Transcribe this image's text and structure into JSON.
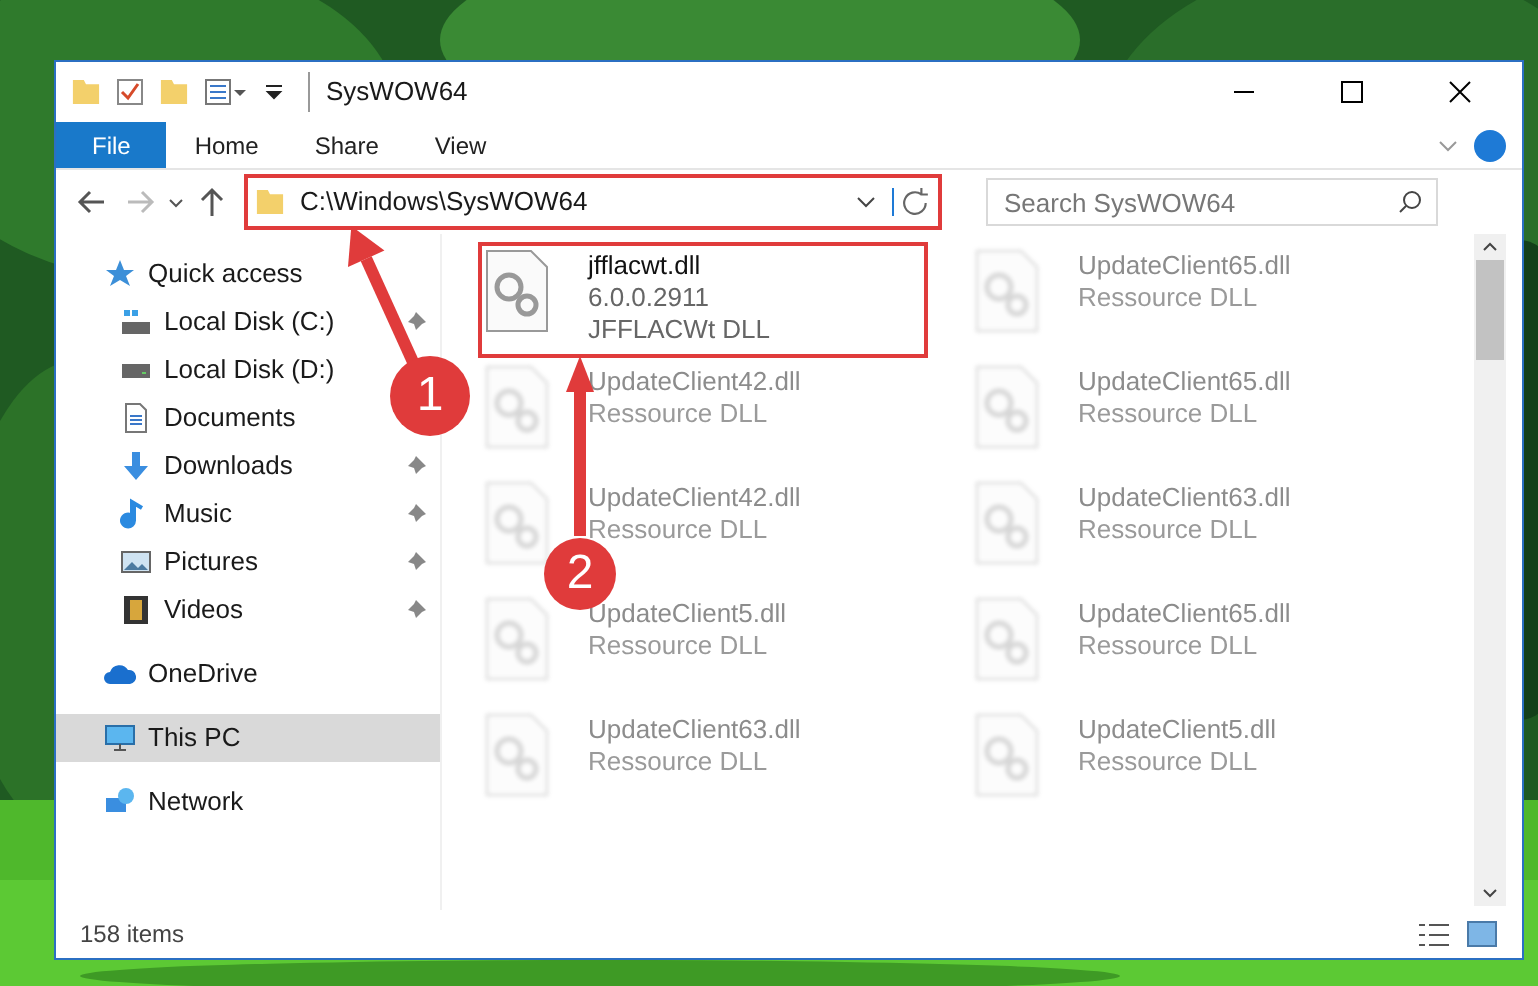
{
  "window": {
    "title": "SysWOW64"
  },
  "ribbon_tabs": [
    {
      "label": "File",
      "selected": true
    },
    {
      "label": "Home",
      "selected": false
    },
    {
      "label": "Share",
      "selected": false
    },
    {
      "label": "View",
      "selected": false
    }
  ],
  "address": {
    "path": "C:\\Windows\\SysWOW64",
    "highlighted": true
  },
  "search": {
    "placeholder": "Search SysWOW64"
  },
  "nav": [
    {
      "label": "Quick access",
      "selected": false,
      "children": [
        {
          "label": "Local Disk (C:)",
          "pinned": true
        },
        {
          "label": "Local Disk (D:)"
        },
        {
          "label": "Documents"
        },
        {
          "label": "Downloads",
          "pinned": true
        },
        {
          "label": "Music",
          "pinned": true
        },
        {
          "label": "Pictures",
          "pinned": true
        },
        {
          "label": "Videos",
          "pinned": true
        }
      ]
    },
    {
      "label": "OneDrive",
      "selected": false
    },
    {
      "label": "This PC",
      "selected": true
    },
    {
      "label": "Network",
      "selected": false
    }
  ],
  "files": [
    {
      "name": "jfflacwt.dll",
      "details": [
        "6.0.0.2911",
        "JFFLACWt DLL"
      ],
      "blurred": false,
      "highlighted": true
    },
    {
      "name": "UpdateClient65.dll",
      "details": [
        "Ressource DLL"
      ],
      "blurred": true,
      "highlighted": false
    },
    {
      "name": "UpdateClient42.dll",
      "details": [
        "Ressource DLL"
      ],
      "blurred": true,
      "highlighted": false
    },
    {
      "name": "UpdateClient65.dll",
      "details": [
        "Ressource DLL"
      ],
      "blurred": true,
      "highlighted": false
    },
    {
      "name": "UpdateClient42.dll",
      "details": [
        "Ressource DLL"
      ],
      "blurred": true,
      "highlighted": false
    },
    {
      "name": "UpdateClient63.dll",
      "details": [
        "Ressource DLL"
      ],
      "blurred": true,
      "highlighted": false
    },
    {
      "name": "UpdateClient5.dll",
      "details": [
        "Ressource DLL"
      ],
      "blurred": true,
      "highlighted": false
    },
    {
      "name": "UpdateClient65.dll",
      "details": [
        "Ressource DLL"
      ],
      "blurred": true,
      "highlighted": false
    },
    {
      "name": "UpdateClient63.dll",
      "details": [
        "Ressource DLL"
      ],
      "blurred": true,
      "highlighted": false
    },
    {
      "name": "UpdateClient5.dll",
      "details": [
        "Ressource DLL"
      ],
      "blurred": true,
      "highlighted": false
    }
  ],
  "status_bar": {
    "count": "158 items"
  },
  "callouts": [
    {
      "label": "1"
    },
    {
      "label": "2"
    }
  ]
}
